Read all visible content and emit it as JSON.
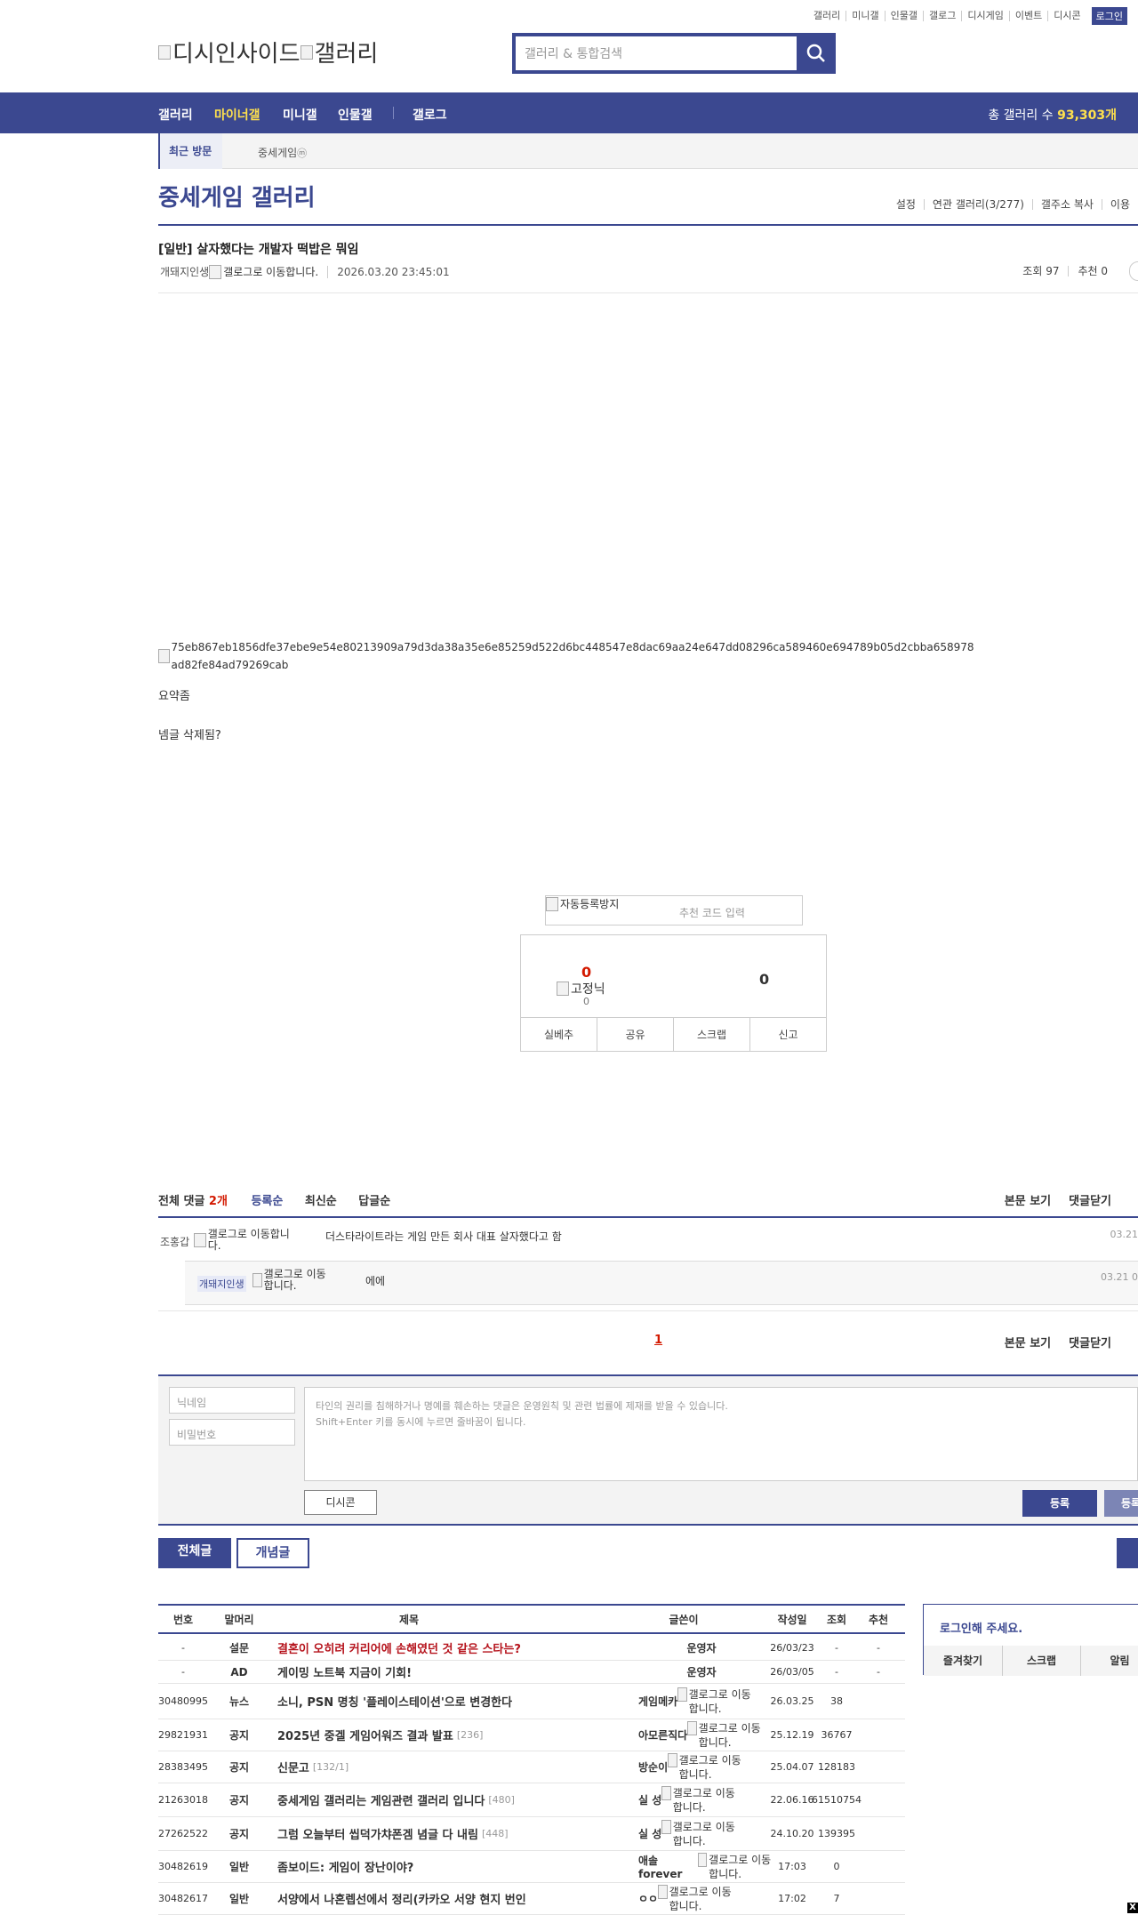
{
  "top_links": [
    "갤러리",
    "미니갤",
    "인물갤",
    "갤로그",
    "디시게임",
    "이벤트",
    "디시콘"
  ],
  "login_label": "로그인",
  "logo": {
    "site_alt": "디시인사이드",
    "gallery_alt": "갤러리"
  },
  "search": {
    "placeholder": "갤러리 & 통합검색"
  },
  "main_nav": {
    "items": [
      "갤러리",
      "마이너갤",
      "미니갤",
      "인물갤",
      "갤로그"
    ],
    "total_label": "총 갤러리 수",
    "total_value": "93,303개"
  },
  "sub_nav": {
    "recent": "최근 방문",
    "gallery": "중세게임",
    "gallery_badge": "ⓜ"
  },
  "gallery": {
    "title": "중세게임 갤러리",
    "menu": [
      "설정",
      "연관 갤러리(3/277)",
      "갤주소 복사",
      "이용"
    ]
  },
  "post": {
    "title": "[일반] 살자했다는 개발자 떡밥은 뭐임",
    "author": "개돼지인생",
    "author_icon_alt": "갤로그로 이동합니다.",
    "date": "2026.03.20 23:45:01",
    "views_label": "조회 97",
    "recommend_label": "추천 0",
    "image_alt": "75eb867eb1856dfe37ebe9e54e80213909a79d3da38a35e6e85259d522d6bc448547e8dac69aa24e647dd08296ca589460e694789b05d2cbba658978ad82fe84ad79269cab",
    "body_lines": [
      "요약좀",
      "넴글 삭제됨?"
    ]
  },
  "captcha": {
    "alt": "자동등록방지",
    "placeholder": "추천 코드 입력"
  },
  "vote": {
    "up": "0",
    "fix_alt": "고정닉",
    "fix_count": "0",
    "down": "0",
    "buttons": [
      "실베추",
      "공유",
      "스크랩",
      "신고"
    ]
  },
  "comments": {
    "total_label": "전체 댓글",
    "total_count": "2개",
    "sorts": [
      "등록순",
      "최신순",
      "답글순"
    ],
    "right_actions": [
      "본문 보기",
      "댓글닫기"
    ],
    "items": [
      {
        "nick": "조홍갑",
        "icon_alt": "갤로그로 이동합니다.",
        "text": "더스타라이트라는 게임 만든 회사 대표 살자했다고 함",
        "time": "03.21"
      },
      {
        "nick": "개돼지인생",
        "icon_alt": "갤로그로 이동합니다.",
        "text": "에에",
        "time": "03.21 0"
      }
    ],
    "page": "1"
  },
  "write": {
    "nick_placeholder": "닉네임",
    "pw_placeholder": "비밀번호",
    "content_placeholder_1": "타인의 권리를 침해하거나 명예를 훼손하는 댓글은 운영원칙 및 관련 법률에 제재를 받을 수 있습니다.",
    "content_placeholder_2": "Shift+Enter 키를 동시에 누르면 줄바꿈이 됩니다.",
    "dccon": "디시콘",
    "submit": "등록",
    "submit2": "등록"
  },
  "tabs": [
    "전체글",
    "개념글"
  ],
  "list": {
    "headers": [
      "번호",
      "말머리",
      "제목",
      "글쓴이",
      "작성일",
      "조회",
      "추천"
    ],
    "rows": [
      {
        "no": "-",
        "head": "설문",
        "title": "결혼이 오히려 커리어에 손해였던 것 같은 스타는?",
        "count": "",
        "writer": "운영자",
        "icon": "",
        "date": "26/03/23",
        "views": "-",
        "rec": "-",
        "red": true
      },
      {
        "no": "-",
        "head": "AD",
        "title": "게이밍 노트북 지금이 기회!",
        "count": "",
        "writer": "운영자",
        "icon": "",
        "date": "26/03/05",
        "views": "-",
        "rec": "-",
        "red": false
      },
      {
        "no": "30480995",
        "head": "뉴스",
        "title": "소니, PSN 명칭 '플레이스테이션'으로 변경한다",
        "count": "",
        "writer": "게임메카",
        "icon": "갤로그로 이동합니다.",
        "date": "26.03.25",
        "views": "38",
        "rec": "",
        "red": false
      },
      {
        "no": "29821931",
        "head": "공지",
        "title": "2025년 중겔 게임어워즈 결과 발표",
        "count": "[236]",
        "writer": "아모른직다",
        "icon": "갤로그로 이동합니다.",
        "date": "25.12.19",
        "views": "36767",
        "rec": "",
        "red": false
      },
      {
        "no": "28383495",
        "head": "공지",
        "title": "신문고",
        "count": "[132/1]",
        "writer": "방순이",
        "icon": "갤로그로 이동합니다.",
        "date": "25.04.07",
        "views": "128183",
        "rec": "",
        "red": false
      },
      {
        "no": "21263018",
        "head": "공지",
        "title": "중세게임 갤러리는 게임관련 갤러리 입니다",
        "count": "[480]",
        "writer": "실 성",
        "icon": "갤로그로 이동합니다.",
        "date": "22.06.16",
        "views": "61510754",
        "rec": "",
        "red": false
      },
      {
        "no": "27262522",
        "head": "공지",
        "title": "그럼 오늘부터 씹덕가챠폰겜 념글 다 내림",
        "count": "[448]",
        "writer": "실 성",
        "icon": "갤로그로 이동합니다.",
        "date": "24.10.20",
        "views": "139395",
        "rec": "",
        "red": false
      },
      {
        "no": "30482619",
        "head": "일반",
        "title": "좀보이드: 게임이 장난이야?",
        "count": "",
        "writer": "애솔forever",
        "icon": "갤로그로 이동합니다.",
        "date": "17:03",
        "views": "0",
        "rec": "",
        "red": false
      },
      {
        "no": "30482617",
        "head": "일반",
        "title": "서양에서 나혼렙선에서 정리(카카오 서양 현지 번인",
        "count": "",
        "writer": "ㅇㅇ",
        "icon": "갤로그로 이동합니다.",
        "date": "17:02",
        "views": "7",
        "rec": "",
        "red": false
      }
    ]
  },
  "login_box": {
    "title": "로그인해 주세요.",
    "links": [
      "즐겨찾기",
      "스크랩",
      "알림"
    ]
  },
  "close_label": "X",
  "colors": {
    "brand": "#3b4890",
    "accent_red": "#d31900",
    "highlight": "#ffe14d"
  }
}
